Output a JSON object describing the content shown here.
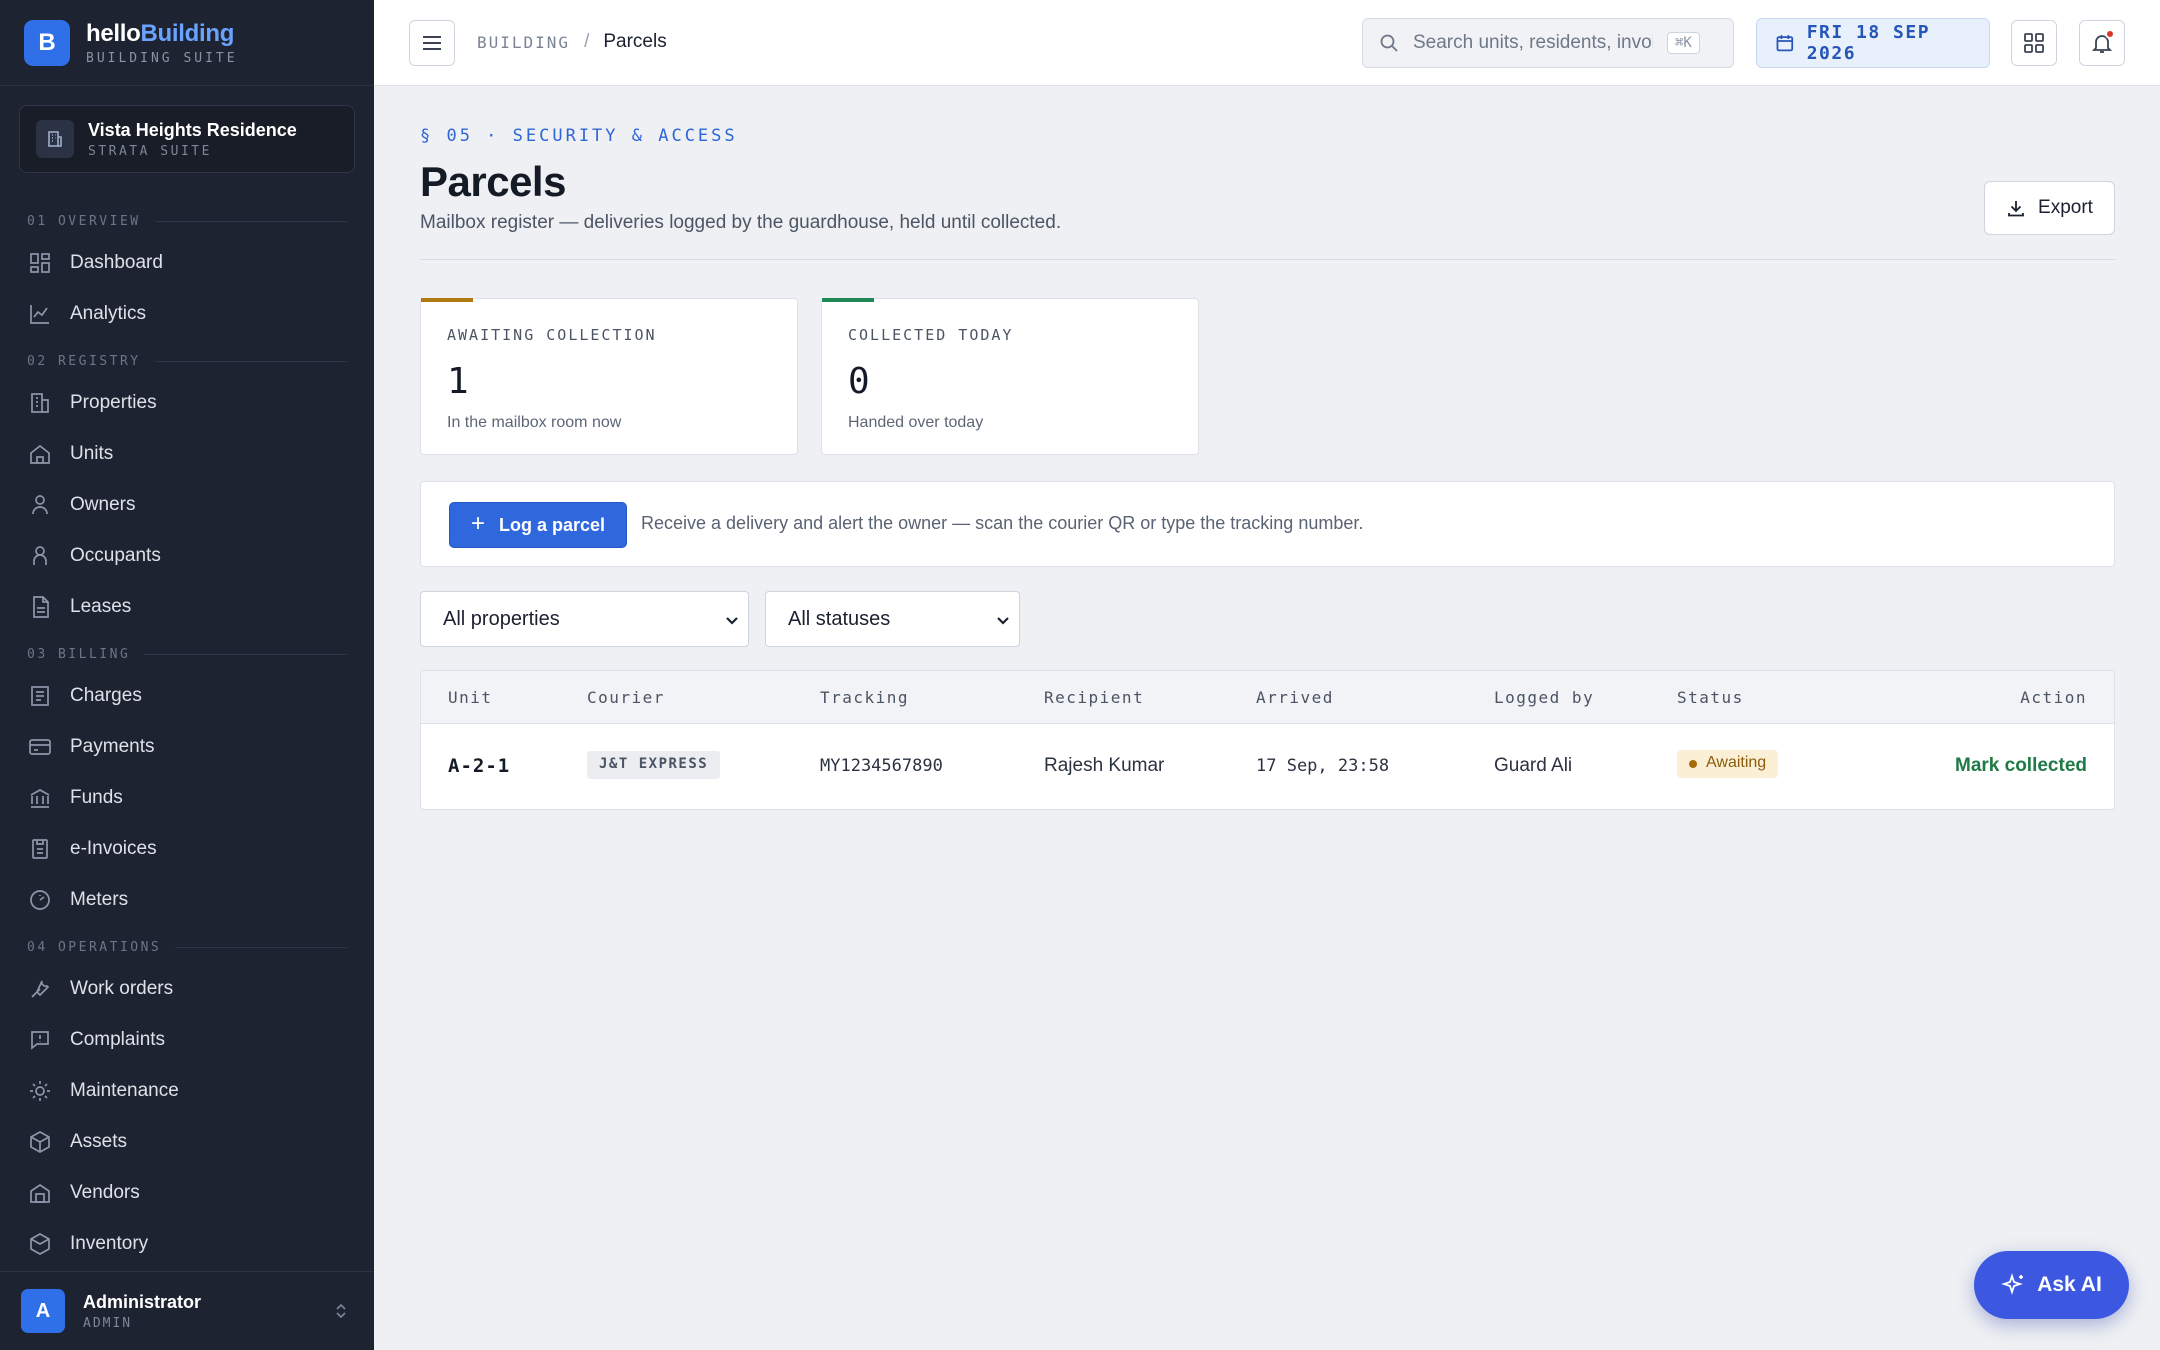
{
  "brand": {
    "logo_letter": "B",
    "name_part1": "hello",
    "name_part2": "Building",
    "subtitle": "BUILDING SUITE",
    "accent": "#2f6fe8"
  },
  "org": {
    "name": "Vista Heights Residence",
    "subtitle": "STRATA SUITE"
  },
  "nav": {
    "sections": [
      {
        "label": "01 OVERVIEW",
        "items": [
          {
            "label": "Dashboard",
            "icon": "dashboard-icon"
          },
          {
            "label": "Analytics",
            "icon": "analytics-icon"
          }
        ]
      },
      {
        "label": "02 REGISTRY",
        "items": [
          {
            "label": "Properties",
            "icon": "building-icon"
          },
          {
            "label": "Units",
            "icon": "home-icon"
          },
          {
            "label": "Owners",
            "icon": "person-icon"
          },
          {
            "label": "Occupants",
            "icon": "person-icon"
          },
          {
            "label": "Leases",
            "icon": "document-icon"
          }
        ]
      },
      {
        "label": "03 BILLING",
        "items": [
          {
            "label": "Charges",
            "icon": "receipt-icon"
          },
          {
            "label": "Payments",
            "icon": "card-icon"
          },
          {
            "label": "Funds",
            "icon": "bank-icon"
          },
          {
            "label": "e-Invoices",
            "icon": "invoice-icon"
          },
          {
            "label": "Meters",
            "icon": "gauge-icon"
          }
        ]
      },
      {
        "label": "04 OPERATIONS",
        "items": [
          {
            "label": "Work orders",
            "icon": "wrench-icon"
          },
          {
            "label": "Complaints",
            "icon": "alert-message-icon"
          },
          {
            "label": "Maintenance",
            "icon": "sun-icon"
          },
          {
            "label": "Assets",
            "icon": "cube-icon"
          },
          {
            "label": "Vendors",
            "icon": "store-icon"
          },
          {
            "label": "Inventory",
            "icon": "box-icon"
          }
        ]
      }
    ]
  },
  "user": {
    "initial": "A",
    "name": "Administrator",
    "role": "ADMIN"
  },
  "topbar": {
    "breadcrumb_root": "BUILDING",
    "breadcrumb_sep": "/",
    "breadcrumb_current": "Parcels",
    "search_placeholder": "Search units, residents, invoi",
    "search_shortcut": "⌘K",
    "date": "FRI 18 SEP 2026"
  },
  "page": {
    "eyebrow": "§ 05 · SECURITY & ACCESS",
    "title": "Parcels",
    "description": "Mailbox register — deliveries logged by the guardhouse, held until collected.",
    "export_label": "Export"
  },
  "stats": [
    {
      "label": "AWAITING COLLECTION",
      "value": "1",
      "note": "In the mailbox room now",
      "color": "#b07a10"
    },
    {
      "label": "COLLECTED TODAY",
      "value": "0",
      "note": "Handed over today",
      "color": "#1f8a56"
    }
  ],
  "log": {
    "button_label": "Log a parcel",
    "hint": "Receive a delivery and alert the owner — scan the courier QR or type the tracking number."
  },
  "filters": {
    "property": "All properties",
    "status": "All statuses"
  },
  "table": {
    "headers": [
      "Unit",
      "Courier",
      "Tracking",
      "Recipient",
      "Arrived",
      "Logged by",
      "Status",
      "Action"
    ],
    "rows": [
      {
        "unit": "A-2-1",
        "courier": "J&T EXPRESS",
        "tracking": "MY1234567890",
        "recipient": "Rajesh Kumar",
        "arrived": "17 Sep, 23:58",
        "logged_by": "Guard Ali",
        "status": "Awaiting",
        "action": "Mark collected"
      }
    ]
  },
  "ask_ai": "Ask AI"
}
